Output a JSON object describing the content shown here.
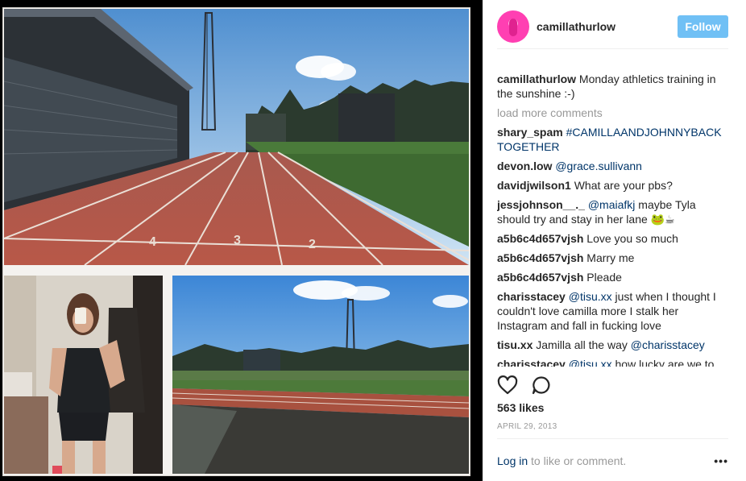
{
  "header": {
    "username": "camillathurlow",
    "follow_label": "Follow"
  },
  "caption": {
    "username": "camillathurlow",
    "text": "Monday athletics training in the sunshine :-)"
  },
  "load_more": "load more comments",
  "comments": [
    {
      "user": "shary_spam",
      "mention": "#CAMILLAANDJOHNNYBACK TOGETHER",
      "text": ""
    },
    {
      "user": "devon.low",
      "mention": "@grace.sullivann",
      "text": ""
    },
    {
      "user": "davidjwilson1",
      "mention": "",
      "text": "What are your pbs?"
    },
    {
      "user": "jessjohnson__._",
      "mention": "@maiafkj",
      "text": "maybe Tyla should try and stay in her lane 🐸☕"
    },
    {
      "user": "a5b6c4d657vjsh",
      "mention": "",
      "text": "Love you so much"
    },
    {
      "user": "a5b6c4d657vjsh",
      "mention": "",
      "text": "Marry me"
    },
    {
      "user": "a5b6c4d657vjsh",
      "mention": "",
      "text": "Pleade"
    },
    {
      "user": "charisstacey",
      "mention": "@tisu.xx",
      "text": "just when I thought I couldn't love camilla more I stalk her Instagram and fall in fucking love"
    },
    {
      "user": "tisu.xx",
      "mention": "",
      "text": "Jamilla all the way",
      "mention_after": "@charisstacey"
    },
    {
      "user": "charisstacey",
      "mention": "@tisu.xx",
      "text": "how lucky are we to"
    }
  ],
  "likes": "563 likes",
  "date": "APRIL 29, 2013",
  "footer": {
    "login_label": "Log in",
    "rest": " to like or comment.",
    "more": "•••"
  },
  "icons": {
    "like": "heart-icon",
    "comment": "comment-icon",
    "more": "more-options-icon"
  },
  "colors": {
    "follow": "#70c0f5",
    "link": "#003569",
    "muted": "#999999"
  }
}
